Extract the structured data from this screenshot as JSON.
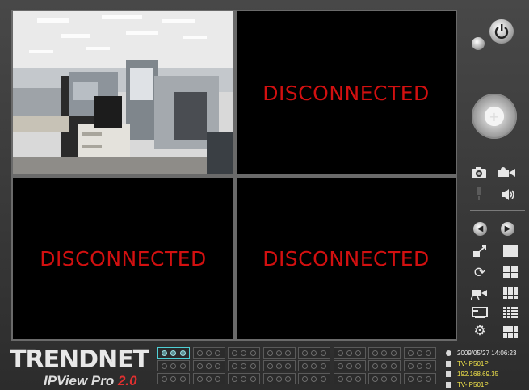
{
  "window": {
    "title": "TRENDnet IPView Pro 2.0"
  },
  "video_grid": {
    "cells": [
      {
        "status": "live",
        "label": ""
      },
      {
        "status": "disconnected",
        "label": "DISCONNECTED"
      },
      {
        "status": "disconnected",
        "label": "DISCONNECTED"
      },
      {
        "status": "disconnected",
        "label": "DISCONNECTED"
      }
    ]
  },
  "branding": {
    "brand": "TRENDnet",
    "product": "IPView Pro",
    "version": "2.0",
    "version_color": "#e03030"
  },
  "info_panel": {
    "datetime": "2009/05/27 14:06:23",
    "camera_name": "TV-IP501P",
    "camera_ip": "192.168.69.35",
    "camera_model": "TV-IP501P",
    "text_color": "#f0e24a"
  },
  "controls": {
    "icons": [
      "minimize-icon",
      "power-icon",
      "ptz-joystick",
      "snapshot-icon",
      "record-icon",
      "microphone-icon",
      "speaker-icon",
      "prev-icon",
      "next-icon",
      "ptz-control-icon",
      "layout-1-icon",
      "refresh-icon",
      "layout-4-icon",
      "camera-setup-icon",
      "layout-9-icon",
      "playback-icon",
      "layout-16-icon",
      "settings-icon",
      "layout-custom-icon"
    ]
  },
  "channel_bar": {
    "rows": 3,
    "cols": 8,
    "active_channel": 1
  },
  "colors": {
    "accent": "#4fd0d6",
    "disconnected_text": "#d21010",
    "background": "#3a3a3a"
  }
}
